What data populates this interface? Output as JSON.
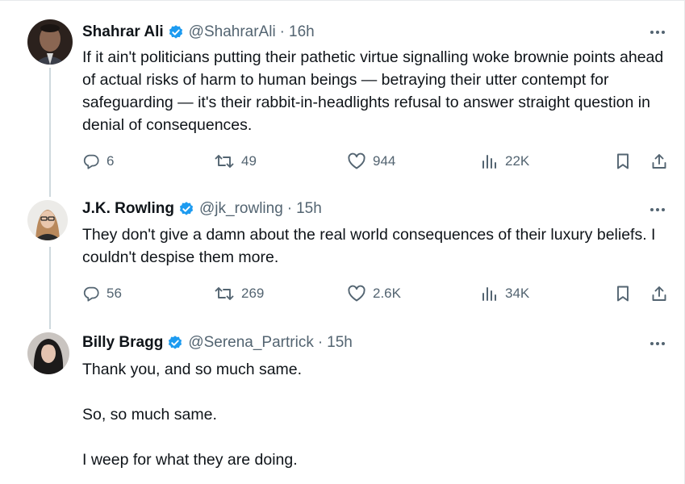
{
  "tweets": [
    {
      "display_name": "Shahrar Ali",
      "handle": "@ShahrarAli",
      "time": "16h",
      "text": "If it ain't politicians putting their pathetic virtue signalling woke brownie points ahead of actual risks of harm to human beings — betraying their utter contempt for safeguarding — it's their rabbit-in-headlights refusal to answer straight question in denial of consequences.",
      "replies": "6",
      "retweets": "49",
      "likes": "944",
      "views": "22K"
    },
    {
      "display_name": "J.K. Rowling",
      "handle": "@jk_rowling",
      "time": "15h",
      "text": "They don't give a damn about the real world consequences of their luxury beliefs. I couldn't despise them more.",
      "replies": "56",
      "retweets": "269",
      "likes": "2.6K",
      "views": "34K"
    },
    {
      "display_name": "Billy Bragg",
      "handle": "@Serena_Partrick",
      "time": "15h",
      "paragraphs": [
        "Thank you, and so much same.",
        "So, so much same.",
        "I weep for what they are doing."
      ]
    }
  ],
  "separator": "·",
  "icons": {
    "verified": "verified-badge-icon",
    "more": "more-horizontal-icon",
    "reply": "reply-icon",
    "retweet": "retweet-icon",
    "like": "like-icon",
    "views": "views-icon",
    "bookmark": "bookmark-icon",
    "share": "share-icon"
  },
  "colors": {
    "verified_badge": "#1d9bf0",
    "secondary_text": "#536471",
    "primary_text": "#0f1419",
    "thread_line": "#cfd9de"
  }
}
